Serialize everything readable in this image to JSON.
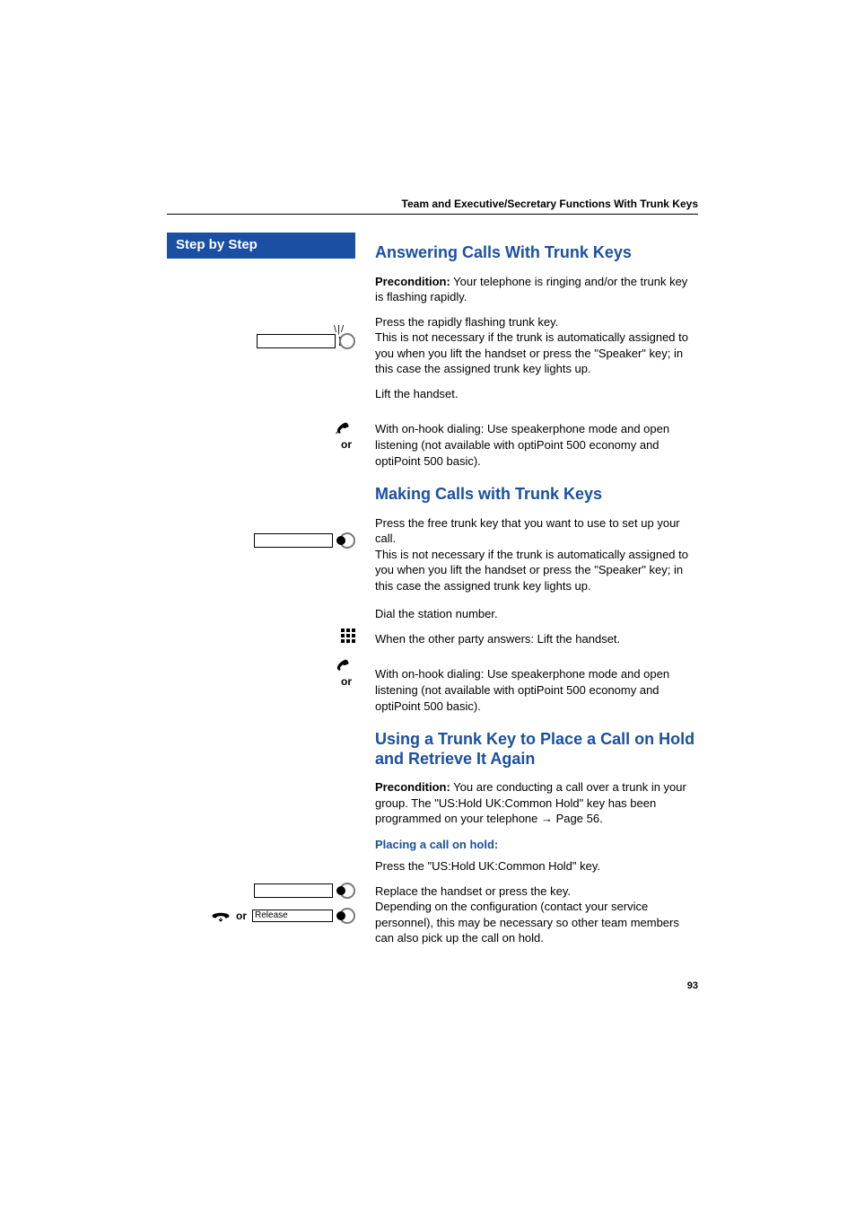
{
  "header": {
    "running_title": "Team and Executive/Secretary Functions With Trunk Keys"
  },
  "sidebar": {
    "title": "Step by Step",
    "release_label": "Release",
    "or1": "or",
    "or2": "or",
    "or3": "or"
  },
  "content": {
    "s1": {
      "title": "Answering Calls With Trunk Keys",
      "precondition_label": "Precondition:",
      "precondition_text": " Your telephone is ringing and/or the trunk key is flashing rapidly.",
      "p1": "Press the rapidly flashing trunk key.\nThis is not necessary if the trunk is automatically assigned to you when you lift the handset or press the \"Speaker\" key; in this case the assigned trunk key lights up.",
      "p2": "Lift the handset.",
      "p3": "With on-hook dialing: Use speakerphone mode and open listening (not available with optiPoint 500 economy and optiPoint 500 basic)."
    },
    "s2": {
      "title": "Making Calls with Trunk Keys",
      "p1": "Press the free trunk key that you want to use to set up your call.\nThis is not necessary if the trunk is automatically assigned to you when you lift the handset or press the \"Speaker\" key; in this case the assigned trunk key lights up.",
      "p2": "Dial the station number.",
      "p3": "When the other party answers: Lift the handset.",
      "p4": "With on-hook dialing: Use speakerphone mode and open listening (not available with optiPoint 500 economy and optiPoint 500 basic)."
    },
    "s3": {
      "title": "Using a Trunk Key to Place a Call on Hold and Retrieve It Again",
      "precondition_label": "Precondition:",
      "precondition_text": " You are conducting a call over a trunk in your group. The \"US:Hold UK:Common Hold\" key has been programmed on your telephone ",
      "precondition_link": "Page 56.",
      "sub1": "Placing a call on hold:",
      "p1": "Press the \"US:Hold UK:Common Hold\" key.",
      "p2": "Replace the handset or press the key.\nDepending on the configuration (contact your service personnel), this may be necessary so other team members can also pick up the call on hold."
    }
  },
  "page_number": "93"
}
